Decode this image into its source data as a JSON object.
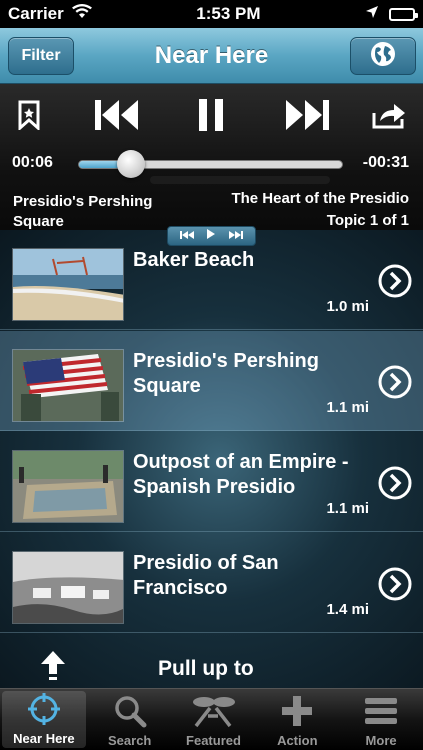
{
  "status_bar": {
    "carrier": "Carrier",
    "time": "1:53 PM"
  },
  "nav": {
    "filter_label": "Filter",
    "title": "Near Here",
    "globe_icon": "globe-icon"
  },
  "player": {
    "elapsed": "00:06",
    "remaining": "-00:31",
    "progress": 0.2,
    "current_stop": "Presidio's Pershing Square",
    "track_title": "The Heart of the Presidio",
    "topic": "Topic 1 of 1"
  },
  "list": {
    "items": [
      {
        "title": "Baker Beach",
        "distance": "1.0 mi",
        "selected": false
      },
      {
        "title": "Presidio's Pershing Square",
        "distance": "1.1 mi",
        "selected": true
      },
      {
        "title": "Outpost of an Empire - Spanish Presidio",
        "distance": "1.1 mi",
        "selected": false
      },
      {
        "title": "Presidio of San Francisco",
        "distance": "1.4 mi",
        "selected": false
      }
    ],
    "pull_text": "Pull up to"
  },
  "tabs": [
    {
      "label": "Near Here",
      "icon": "crosshair-icon",
      "active": true
    },
    {
      "label": "Search",
      "icon": "search-icon",
      "active": false
    },
    {
      "label": "Featured",
      "icon": "featured-icon",
      "active": false
    },
    {
      "label": "Action",
      "icon": "plus-icon",
      "active": false
    },
    {
      "label": "More",
      "icon": "menu-icon",
      "active": false
    }
  ],
  "colors": {
    "nav_top": "#8ec9de",
    "nav_bottom": "#3f8cab",
    "list_bg": "#17303d",
    "selected_row": "#5e8aa3"
  }
}
